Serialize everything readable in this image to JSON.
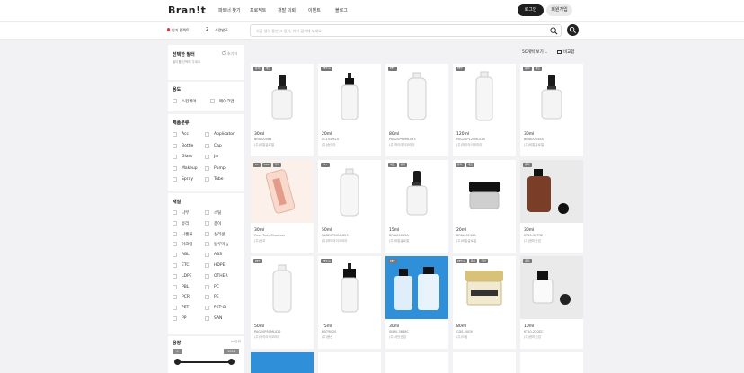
{
  "header": {
    "logo": "Bran!t",
    "nav": [
      "파트너 찾기",
      "프로젝트",
      "개발 의뢰",
      "이벤트",
      "블로그"
    ],
    "login": "로그인",
    "join": "회원가입"
  },
  "subbar": {
    "location": "인기 컬렉트",
    "count": "2",
    "location_sub": "소량발주",
    "search_placeholder": "지금 생각 중인 그 용기, 하이 검색해 보세요"
  },
  "filters": {
    "title": "선택한 필터",
    "subtitle": "필터를 선택해 주세요",
    "reset": "초기화",
    "usage_title": "용도",
    "usage": [
      "스킨케어",
      "메이크업"
    ],
    "category_title": "제품분류",
    "category": [
      [
        "Acc",
        "Applicator"
      ],
      [
        "Bottle",
        "Cap"
      ],
      [
        "Glass",
        "Jar"
      ],
      [
        "Makeup",
        "Pump"
      ],
      [
        "Spray",
        "Tube"
      ]
    ],
    "material_title": "재질",
    "material": [
      [
        "나무",
        "스틸"
      ],
      [
        "유리",
        "종이"
      ],
      [
        "니켈류",
        "실리콘"
      ],
      [
        "아크릴",
        "알루미늄"
      ],
      [
        "ABL",
        "ABS"
      ],
      [
        "ETC",
        "HDPE"
      ],
      [
        "LDPE",
        "OTHER"
      ],
      [
        "PBL",
        "PC"
      ],
      [
        "PCR",
        "PE"
      ],
      [
        "PET",
        "PET-G"
      ],
      [
        "PP",
        "SAN"
      ]
    ],
    "capacity_title": "용량",
    "capacity_unit": "ml단위",
    "capacity_min": "0",
    "capacity_max": "1000",
    "capacity_min_frac": 0.0,
    "capacity_max_frac": 1.0
  },
  "toolbar": {
    "sort": "50개씩 보기",
    "compare": "비교함"
  },
  "products": [
    {
      "tags": [
        "유리",
        "세트"
      ],
      "vol": "30ml",
      "code": "BRIA00068",
      "company": "(주)비알글로벌"
    },
    {
      "tags": [
        "PET-G"
      ],
      "vol": "20ml",
      "code": "SC155M24",
      "company": "(주)송이타"
    },
    {
      "tags": [
        "PET"
      ],
      "vol": "80ml",
      "code": "PAG20P80ML033",
      "company": "(주)하이아이코리아"
    },
    {
      "tags": [
        "PET"
      ],
      "vol": "120ml",
      "code": "PAG20P120ML025",
      "company": "(주)하이아이코리아"
    },
    {
      "tags": [
        "유리",
        "세트"
      ],
      "vol": "30ml",
      "code": "BRIA00045A",
      "company": "(주)비알글로벌"
    },
    {
      "tags": [
        "PP",
        "ABS",
        "기타"
      ],
      "vol": "30ml",
      "code": "Over Twin Chamber",
      "company": "(주)현코"
    },
    {
      "tags": [
        "PET"
      ],
      "vol": "50ml",
      "code": "PAG20P50ML023",
      "company": "(주)하이아이코리아"
    },
    {
      "tags": [
        "세트",
        "유리"
      ],
      "vol": "15ml",
      "code": "BRIA00055A",
      "company": "(주)비알글로벌"
    },
    {
      "tags": [
        "유리",
        "세트"
      ],
      "vol": "20ml",
      "code": "BRIA00110A",
      "company": "(주)비알글로벌"
    },
    {
      "tags": [
        "유리"
      ],
      "vol": "30ml",
      "code": "KT30-30TR2",
      "company": "(주)한미산업"
    },
    {
      "tags": [
        "PET"
      ],
      "vol": "50ml",
      "code": "PAG20P50ML022",
      "company": "(주)하이아이코리아"
    },
    {
      "tags": [
        "PET-G"
      ],
      "vol": "75ml",
      "code": "BB75N20",
      "company": "(주)용산"
    },
    {
      "tags": [
        "PET"
      ],
      "vol": "30ml",
      "code": "SN30-3868C",
      "company": "(주)서안산업"
    },
    {
      "tags": [
        "PET-G",
        "유리",
        "기타"
      ],
      "vol": "80ml",
      "code": "CDS-50GV",
      "company": "(주)드림"
    },
    {
      "tags": [
        "유리"
      ],
      "vol": "10ml",
      "code": "KT10-220ZC",
      "company": "(주)한미산업"
    }
  ],
  "colors": {
    "accent": "#1e1e1e",
    "hot": "#e53935",
    "blue_tile": "#2f8fd8",
    "brown": "#7a3e28"
  }
}
